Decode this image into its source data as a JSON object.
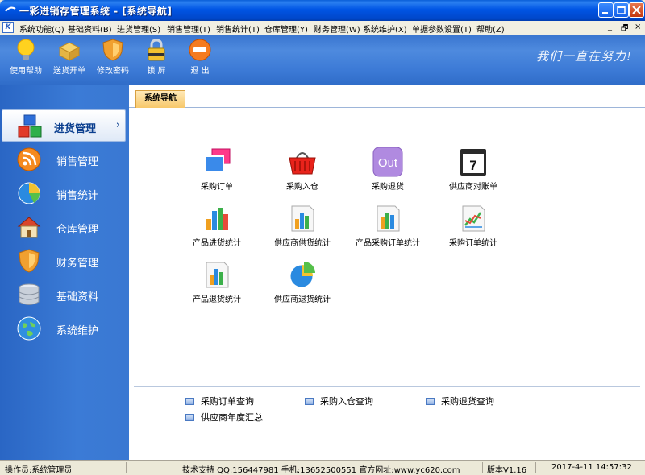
{
  "window": {
    "title": "一彩进销存管理系统 - [系统导航]"
  },
  "menu": [
    "系统功能(Q)",
    "基础资料(B)",
    "进货管理(S)",
    "销售管理(T)",
    "销售统计(T)",
    "仓库管理(Y)",
    "财务管理(W)",
    "系统维护(X)",
    "单据参数设置(T)",
    "帮助(Z)"
  ],
  "mdi_controls": [
    "_",
    "🗗",
    "×"
  ],
  "toolbar": [
    {
      "label": "使用帮助",
      "icon": "lightbulb-icon"
    },
    {
      "label": "送货开单",
      "icon": "delivery-box-icon"
    },
    {
      "label": "修改密码",
      "icon": "shield-icon"
    },
    {
      "label": "锁    屏",
      "icon": "lock-icon"
    },
    {
      "label": "退    出",
      "icon": "exit-icon"
    }
  ],
  "slogan": "我们一直在努力!",
  "sidebar": [
    {
      "label": "进货管理",
      "icon": "purchase-blocks-icon",
      "active": true
    },
    {
      "label": "销售管理",
      "icon": "rss-sales-icon",
      "active": false
    },
    {
      "label": "销售统计",
      "icon": "pie-chart-icon",
      "active": false
    },
    {
      "label": "仓库管理",
      "icon": "warehouse-icon",
      "active": false
    },
    {
      "label": "财务管理",
      "icon": "finance-shield-icon",
      "active": false
    },
    {
      "label": "基础资料",
      "icon": "database-icon",
      "active": false
    },
    {
      "label": "系统维护",
      "icon": "globe-icon",
      "active": false
    }
  ],
  "tab_label": "系统导航",
  "functions": [
    {
      "label": "采购订单",
      "icon": "purchase-order-icon"
    },
    {
      "label": "采购入仓",
      "icon": "basket-icon"
    },
    {
      "label": "采购退货",
      "icon": "out-icon",
      "icon_text": "Out"
    },
    {
      "label": "供应商对账单",
      "icon": "calendar-icon",
      "icon_text": "7"
    },
    {
      "label": "产品进货统计",
      "icon": "bar-chart-icon"
    },
    {
      "label": "供应商供货统计",
      "icon": "bar-chart-page-icon"
    },
    {
      "label": "产品采购订单统计",
      "icon": "bar-chart-page-icon"
    },
    {
      "label": "采购订单统计",
      "icon": "line-chart-page-icon"
    },
    {
      "label": "产品退货统计",
      "icon": "bar-chart-page-icon"
    },
    {
      "label": "供应商退货统计",
      "icon": "pie-chart-icon"
    }
  ],
  "query_links": [
    "采购订单查询",
    "采购入仓查询",
    "采购退货查询",
    "供应商年度汇总"
  ],
  "status": {
    "operator": "操作员:系统管理员",
    "support": "技术支持 QQ:156447981 手机:13652500551 官方网址:www.yc620.com",
    "version": "版本V1.16",
    "datetime": "2017-4-11 14:57:32"
  },
  "colors": {
    "titlebar": "#0055e5",
    "sidebar": "#3b7bd6",
    "toolbar": "#4e8ade",
    "tab": "#f7c86a"
  }
}
